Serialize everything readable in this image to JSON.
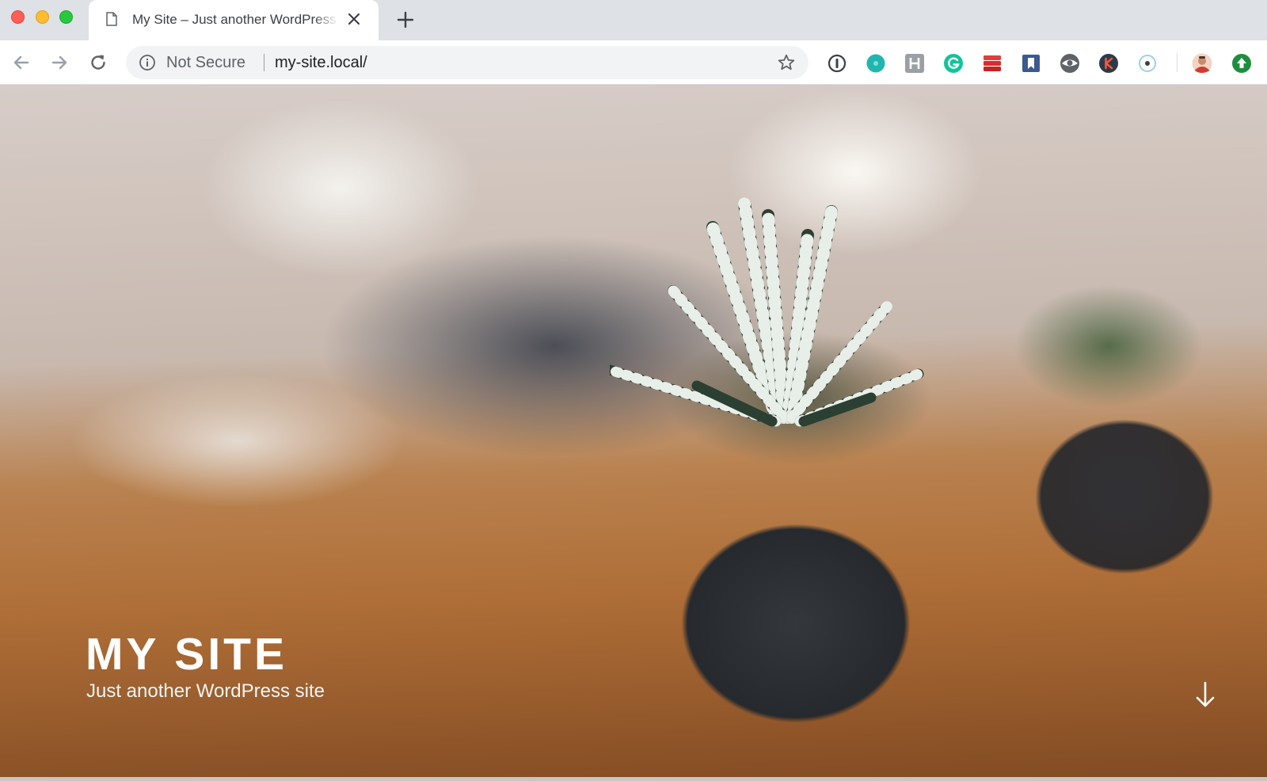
{
  "browser": {
    "tab": {
      "title": "My Site – Just another WordPress site",
      "favicon": "document-icon"
    },
    "address_bar": {
      "security_label": "Not Secure",
      "url": "my-site.local/"
    },
    "extensions": [
      "1password-icon",
      "teal-circle-icon",
      "h-icon",
      "grammarly-icon",
      "red-stack-icon",
      "bookmark-icon",
      "eye-icon",
      "k-icon",
      "target-icon",
      "profile-avatar",
      "update-arrow-icon"
    ]
  },
  "hero": {
    "site_title": "MY SITE",
    "tagline": "Just another WordPress site",
    "scroll_icon": "arrow-down-icon"
  },
  "colors": {
    "close_red": "#fe5f57",
    "minimize_yellow": "#febc2e",
    "zoom_green": "#28c840",
    "tab_strip": "#dee1e6",
    "omnibox": "#f1f3f4"
  }
}
